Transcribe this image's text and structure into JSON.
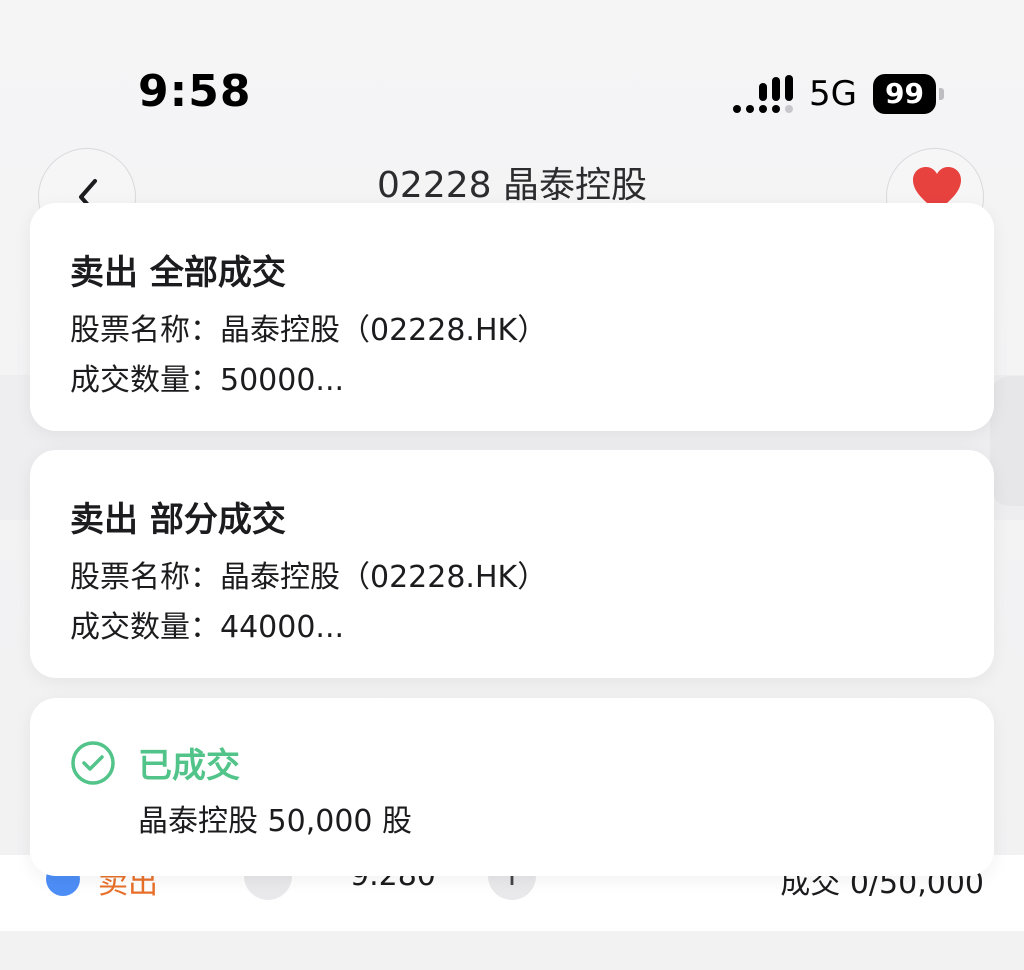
{
  "status_bar": {
    "time": "9:58",
    "network": "5G",
    "battery": "99"
  },
  "header": {
    "title": "02228 晶泰控股"
  },
  "notifications": [
    {
      "title": "卖出 全部成交",
      "line1": "股票名称：晶泰控股（02228.HK）",
      "line2": "成交数量：50000..."
    },
    {
      "title": "卖出 部分成交",
      "line1": "股票名称：晶泰控股（02228.HK）",
      "line2": "成交数量：44000..."
    }
  ],
  "toast": {
    "title": "已成交",
    "text": "晶泰控股 50,000 股",
    "color": "#52c48a"
  },
  "order_row": {
    "side": "卖出",
    "minus": "−",
    "price": "9.280",
    "plus": "+",
    "filled": "成交 0/50,000"
  },
  "colors": {
    "favorite": "#e8423f",
    "sell": "#e8702a",
    "success": "#52c48a"
  }
}
